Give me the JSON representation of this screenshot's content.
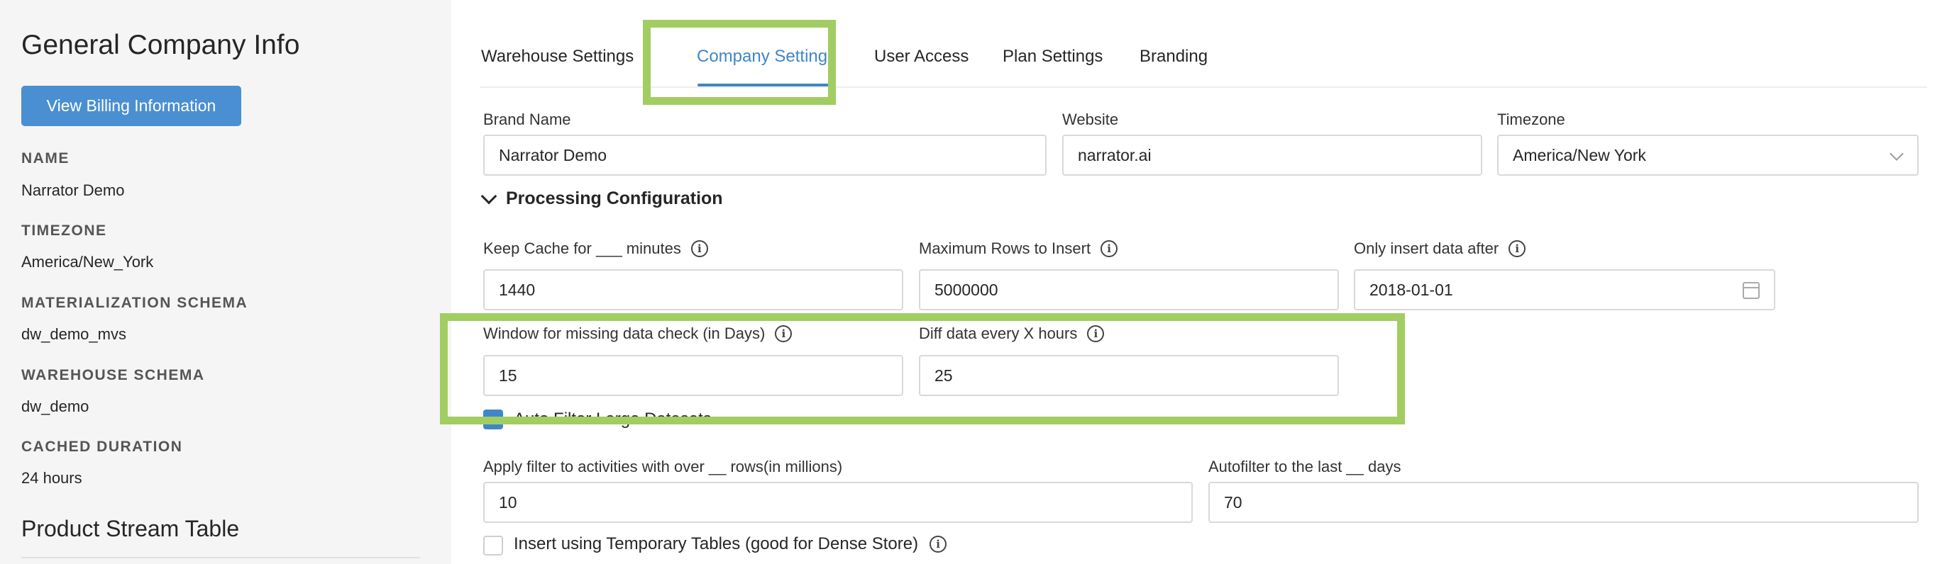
{
  "sidebar": {
    "title": "General Company Info",
    "billing_button": "View Billing Information",
    "fields": [
      {
        "label": "NAME",
        "value": "Narrator Demo"
      },
      {
        "label": "TIMEZONE",
        "value": "America/New_York"
      },
      {
        "label": "MATERIALIZATION SCHEMA",
        "value": "dw_demo_mvs"
      },
      {
        "label": "WAREHOUSE SCHEMA",
        "value": "dw_demo"
      },
      {
        "label": "CACHED DURATION",
        "value": "24 hours"
      }
    ],
    "section2_title": "Product Stream Table"
  },
  "tabs": [
    "Warehouse Settings",
    "Company Settings",
    "User Access",
    "Plan Settings",
    "Branding"
  ],
  "active_tab": "Company Settings",
  "form": {
    "brand_name": {
      "label": "Brand Name",
      "value": "Narrator Demo"
    },
    "website": {
      "label": "Website",
      "value": "narrator.ai"
    },
    "timezone": {
      "label": "Timezone",
      "value": "America/New York"
    },
    "section_title": "Processing Configuration",
    "keep_cache": {
      "label": "Keep Cache for ___ minutes",
      "value": "1440"
    },
    "max_rows": {
      "label": "Maximum Rows to Insert",
      "value": "5000000"
    },
    "insert_after": {
      "label": "Only insert data after",
      "value": "2018-01-01"
    },
    "missing_window": {
      "label": "Window for missing data check (in Days)",
      "value": "15"
    },
    "diff_hours": {
      "label": "Diff data every X hours",
      "value": "25"
    },
    "auto_filter": {
      "label": "Auto Filter Large Datasets",
      "checked": true
    },
    "apply_filter": {
      "label": "Apply filter to activities with over __ rows(in millions)",
      "value": "10"
    },
    "autofilter_days": {
      "label": "Autofilter to the last __ days",
      "value": "70"
    },
    "temp_tables": {
      "label": "Insert using Temporary Tables (good for Dense Store)",
      "checked": false
    }
  },
  "colors": {
    "accent": "#3f86c8",
    "highlight": "#a1cd62",
    "sidebar_bg": "#f5f5f5"
  }
}
